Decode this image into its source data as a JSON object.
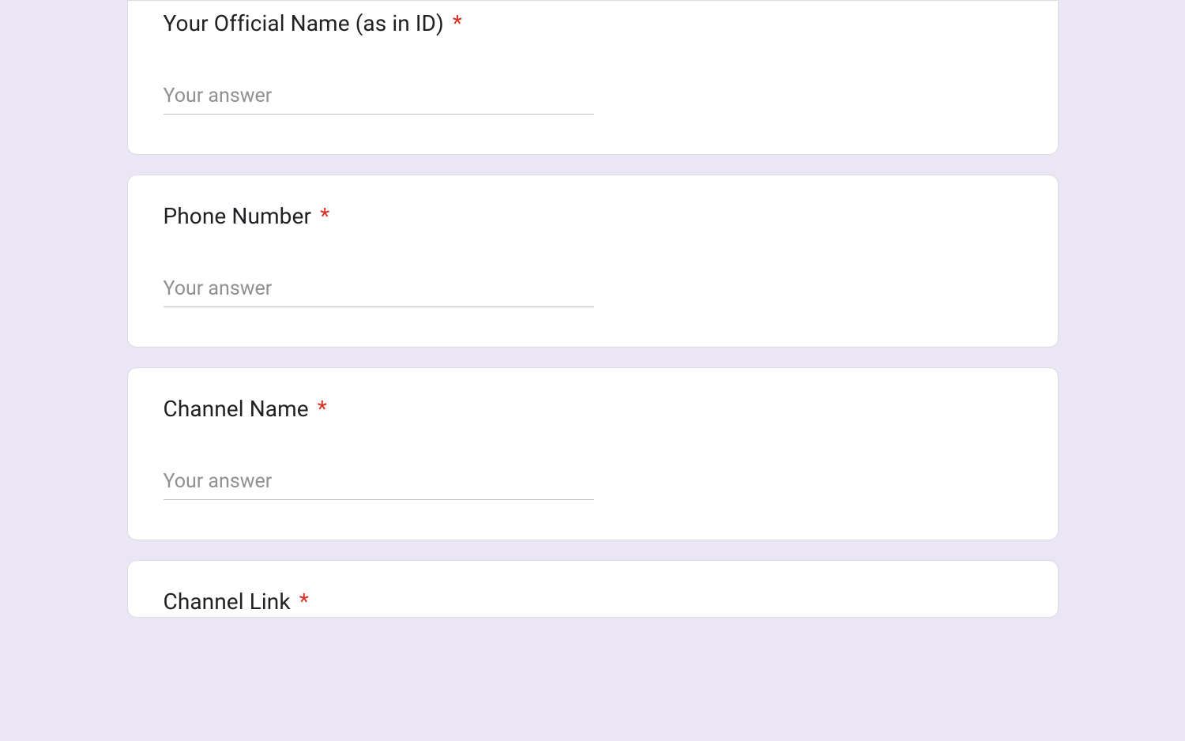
{
  "form": {
    "placeholder": "Your answer",
    "questions": [
      {
        "label": "Your Official Name (as in ID)",
        "required": true
      },
      {
        "label": "Phone Number",
        "required": true
      },
      {
        "label": "Channel Name",
        "required": true
      },
      {
        "label": "Channel Link",
        "required": true
      }
    ]
  }
}
